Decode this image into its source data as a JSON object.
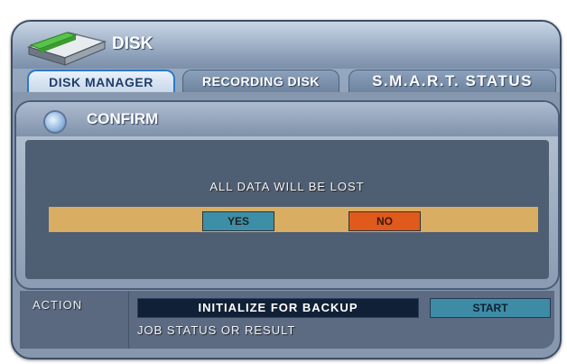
{
  "window": {
    "title": "DISK",
    "icon": "disk-drive-icon"
  },
  "tabs": [
    {
      "label": "DISK MANAGER",
      "active": true
    },
    {
      "label": "RECORDING DISK",
      "active": false
    },
    {
      "label": "S.M.A.R.T. STATUS",
      "active": false
    }
  ],
  "confirm": {
    "title": "CONFIRM",
    "icon": "circle-icon",
    "message": "ALL DATA WILL BE LOST",
    "yes_label": "YES",
    "no_label": "NO"
  },
  "action": {
    "label": "ACTION",
    "selected": "INITIALIZE FOR BACKUP",
    "start_label": "START",
    "status_text": "JOB STATUS OR RESULT"
  },
  "colors": {
    "accent": "#2d78c8",
    "yes_button": "#3d8fa7",
    "no_button": "#e05a1c",
    "bar": "#d9ad62"
  }
}
